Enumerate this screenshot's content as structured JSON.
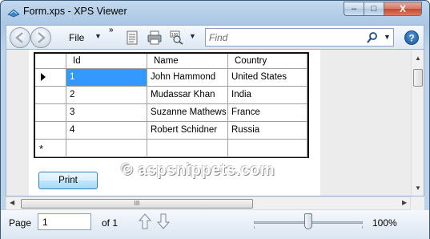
{
  "window": {
    "title": "Form.xps - XPS Viewer",
    "minimize_glyph": "–",
    "maximize_glyph": "□",
    "close_glyph": "X"
  },
  "toolbar": {
    "file_label": "File",
    "file_caret": "▼",
    "overflow_glyph": "»",
    "zoom_caret": "▼",
    "find_placeholder": "Find",
    "find_caret": "▼",
    "icons": [
      "back-icon",
      "forward-icon",
      "document-icon",
      "print-icon",
      "zoom-icon",
      "search-icon",
      "help-icon"
    ]
  },
  "grid": {
    "columns": [
      "Id",
      "Name",
      "Country"
    ],
    "rows": [
      {
        "id": "1",
        "name": "John Hammond",
        "country": "United States"
      },
      {
        "id": "2",
        "name": "Mudassar Khan",
        "country": "India"
      },
      {
        "id": "3",
        "name": "Suzanne Mathews",
        "country": "France"
      },
      {
        "id": "4",
        "name": "Robert Schidner",
        "country": "Russia"
      }
    ],
    "selected_row": 0,
    "new_row_glyph": "*"
  },
  "form": {
    "print_label": "Print"
  },
  "watermark": {
    "text": "© aspsnippets.com"
  },
  "scrollbars": {
    "up_glyph": "▲",
    "down_glyph": "▼",
    "left_glyph": "◀",
    "right_glyph": "▶",
    "grip_glyph": "III"
  },
  "status": {
    "page_label": "Page",
    "page_value": "1",
    "page_of": "of 1",
    "zoom_level": "100%",
    "zoom_fraction": 0.5
  },
  "colors": {
    "selection": "#3399ff",
    "accent": "#3c7fb1"
  }
}
